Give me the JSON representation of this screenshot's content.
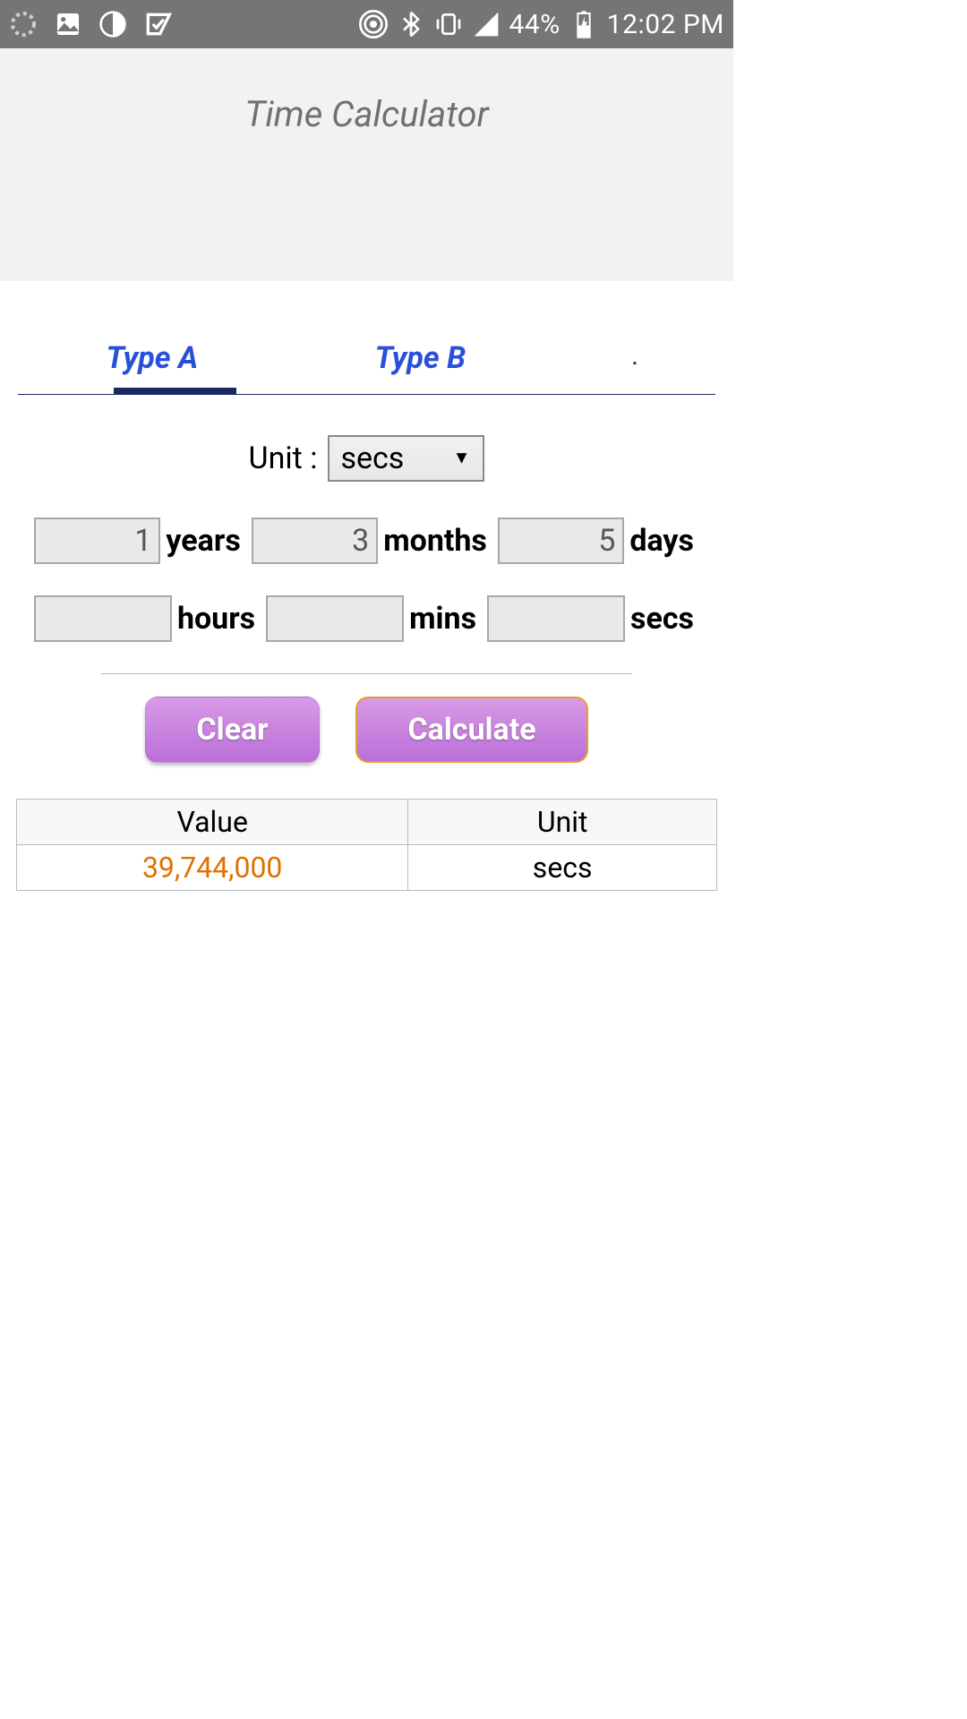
{
  "status": {
    "battery": "44%",
    "time": "12:02 PM"
  },
  "header": {
    "title": "Time Calculator"
  },
  "tabs": {
    "a": "Type A",
    "b": "Type B",
    "c": "."
  },
  "unit": {
    "label": "Unit :",
    "selected": "secs"
  },
  "inputs": {
    "years": {
      "value": "1",
      "label": "years"
    },
    "months": {
      "value": "3",
      "label": "months"
    },
    "days": {
      "value": "5",
      "label": "days"
    },
    "hours": {
      "value": "",
      "label": "hours"
    },
    "mins": {
      "value": "",
      "label": "mins"
    },
    "secs": {
      "value": "",
      "label": "secs"
    }
  },
  "buttons": {
    "clear": "Clear",
    "calculate": "Calculate"
  },
  "result": {
    "headers": {
      "value": "Value",
      "unit": "Unit"
    },
    "value": "39,744,000",
    "unit": "secs"
  }
}
